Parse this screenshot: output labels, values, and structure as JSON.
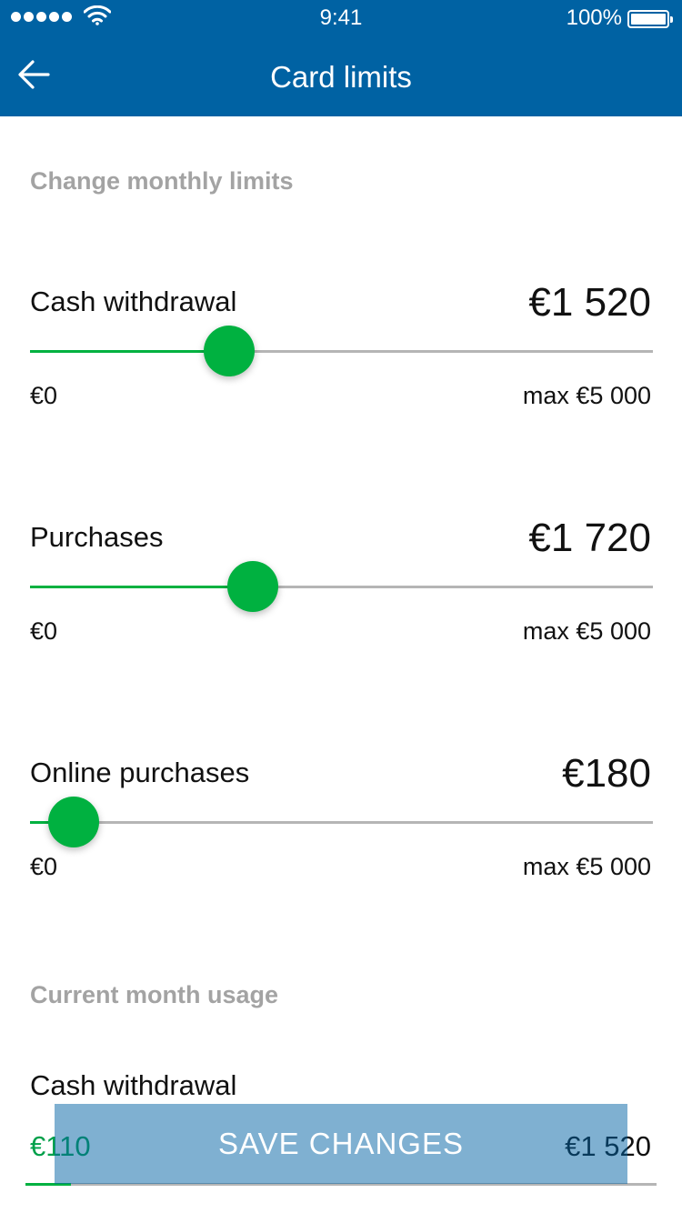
{
  "status_bar": {
    "time": "9:41",
    "battery": "100%"
  },
  "nav": {
    "title": "Card limits",
    "back_icon": "arrow-left-icon"
  },
  "sections": {
    "limits_title": "Change monthly limits",
    "usage_title": "Current month usage"
  },
  "limits": [
    {
      "label": "Cash withdrawal",
      "value": "€1 520",
      "min": "€0",
      "max": "max €5 000",
      "fraction": 0.319
    },
    {
      "label": "Purchases",
      "value": "€1 720",
      "min": "€0",
      "max": "max €5 000",
      "fraction": 0.357
    },
    {
      "label": "Online purchases",
      "value": "€180",
      "min": "€0",
      "max": "max €5 000",
      "fraction": 0.07
    }
  ],
  "usage": {
    "label": "Cash withdrawal",
    "spent": "€110",
    "limit": "€1 520",
    "fraction": 0.072
  },
  "actions": {
    "save_label": "SAVE CHANGES"
  },
  "colors": {
    "brand": "#0062a3",
    "accent": "#00b140",
    "muted": "#a3a3a3"
  }
}
